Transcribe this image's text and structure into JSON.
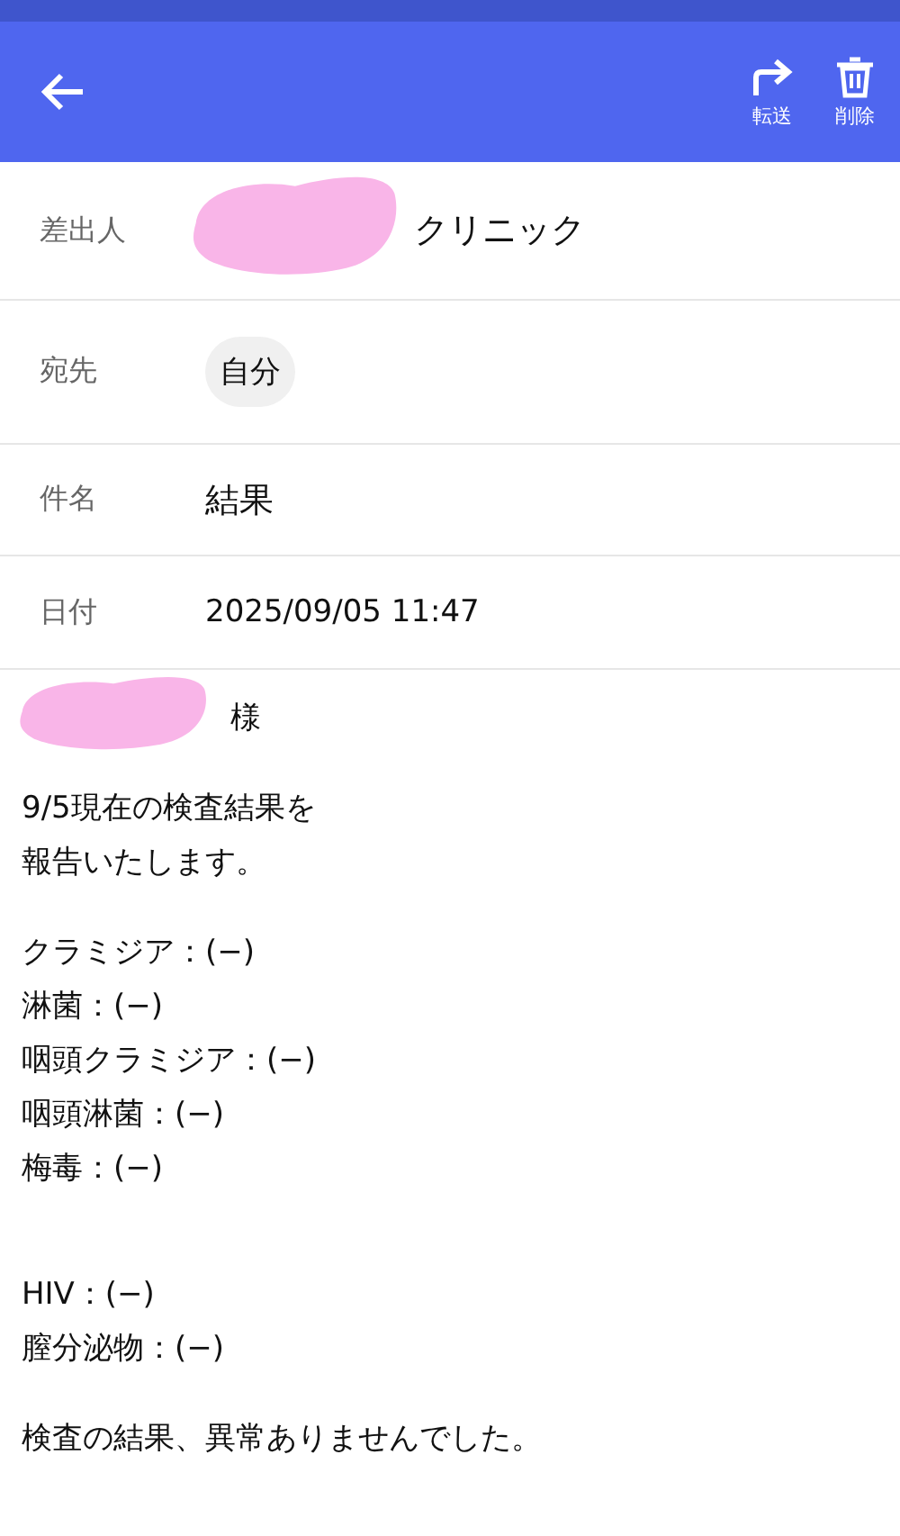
{
  "app_bar": {
    "actions": [
      {
        "kind": "forward",
        "label": "転送"
      },
      {
        "kind": "delete",
        "label": "削除"
      }
    ]
  },
  "fields": [
    {
      "kind": "sender",
      "label": "差出人",
      "value": "クリニック",
      "redacted": true
    },
    {
      "kind": "chip",
      "label": "宛先",
      "value": "自分"
    },
    {
      "kind": "subject",
      "label": "件名",
      "value": "結果"
    },
    {
      "kind": "date",
      "label": "日付",
      "value": "2025/09/05 11:47"
    }
  ],
  "body": [
    {
      "kind": "greeting",
      "text": "様",
      "redacted": true
    },
    {
      "kind": "spacer"
    },
    {
      "kind": "line",
      "text": "9/5現在の検査結果を"
    },
    {
      "kind": "line",
      "text": "報告いたします。"
    },
    {
      "kind": "spacer"
    },
    {
      "kind": "line",
      "text": "クラミジア：(−)"
    },
    {
      "kind": "line",
      "text": "淋菌：(−)"
    },
    {
      "kind": "line",
      "text": "咽頭クラミジア：(−)"
    },
    {
      "kind": "line",
      "text": "咽頭淋菌：(−)"
    },
    {
      "kind": "line",
      "text": "梅毒：(−)"
    },
    {
      "kind": "spacer"
    },
    {
      "kind": "spacer"
    },
    {
      "kind": "line",
      "text": "HIV：(−)"
    },
    {
      "kind": "line",
      "text": "膣分泌物：(−)"
    },
    {
      "kind": "spacer"
    },
    {
      "kind": "line",
      "text": "検査の結果、異常ありませんでした。"
    }
  ]
}
